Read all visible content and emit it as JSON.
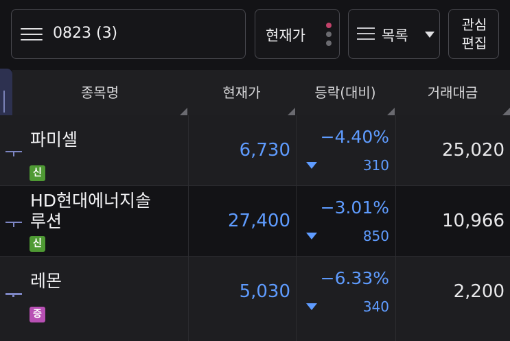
{
  "toolbar": {
    "group_name": "0823 (3)",
    "price_type": "현재가",
    "view_mode": "목록",
    "edit_line1": "관심",
    "edit_line2": "편집"
  },
  "columns": {
    "name": "종목명",
    "price": "현재가",
    "change": "등락(대비)",
    "volume": "거래대금"
  },
  "rows": [
    {
      "name_line1": "파미셀",
      "name_line2": "",
      "badge": "신",
      "badge_color": "#4f9a34",
      "price": "6,730",
      "rate": "−4.40%",
      "diff": "310",
      "volume": "25,020"
    },
    {
      "name_line1": "HD현대에너지솔",
      "name_line2": "루션",
      "badge": "신",
      "badge_color": "#4f9a34",
      "price": "27,400",
      "rate": "−3.01%",
      "diff": "850",
      "volume": "10,966"
    },
    {
      "name_line1": "레몬",
      "name_line2": "",
      "badge": "증",
      "badge_color": "#b850b4",
      "price": "5,030",
      "rate": "−6.33%",
      "diff": "340",
      "volume": "2,200"
    }
  ],
  "colors": {
    "background": "#131316",
    "down": "#5f9cff",
    "dot_top": "#c2426a",
    "dot_mid": "#6b6b70",
    "dot_bottom": "#6b6b70"
  },
  "icons": [
    "hamburger-menu-icon",
    "more-dots-icon",
    "list-icon",
    "dropdown-caret-icon",
    "pin-icon",
    "down-triangle-icon"
  ]
}
